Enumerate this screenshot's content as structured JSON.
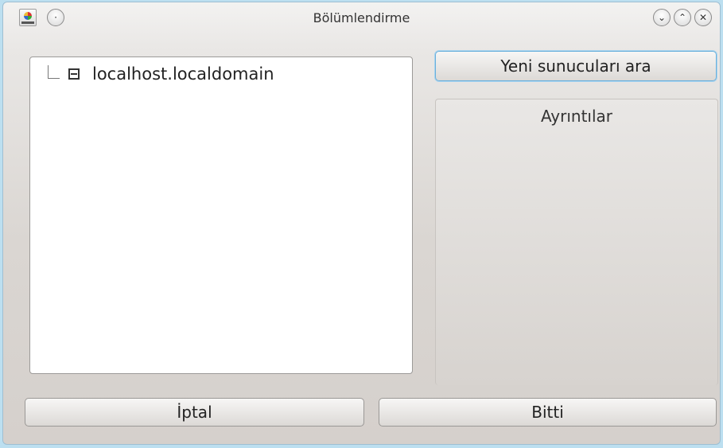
{
  "window": {
    "title": "Bölümlendirme"
  },
  "tree": {
    "items": [
      {
        "label": "localhost.localdomain",
        "icon": "computer-icon"
      }
    ]
  },
  "actions": {
    "search_new_servers_label": "Yeni sunucuları ara",
    "details_title": "Ayrıntılar",
    "cancel_label": "İptal",
    "done_label": "Bitti"
  },
  "colors": {
    "focus_border": "#6ab0dc",
    "list_background": "#ffffff",
    "window_background": "#e4e1de"
  }
}
